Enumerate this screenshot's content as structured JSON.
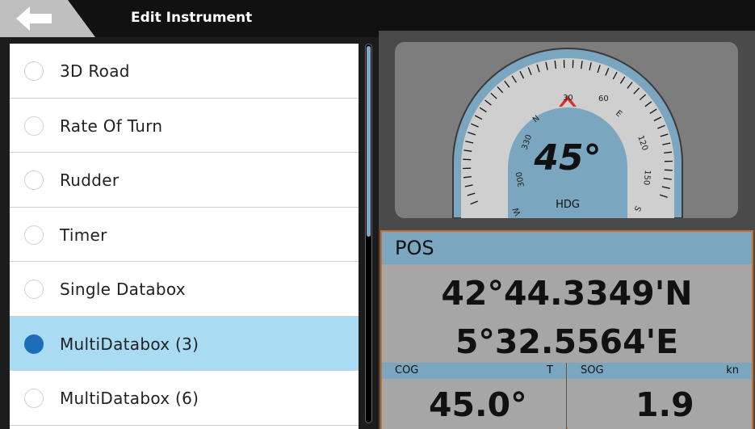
{
  "header": {
    "title": "Edit Instrument",
    "back_icon": "left-arrow-icon"
  },
  "list": {
    "items": [
      {
        "label": "3D Road",
        "selected": false
      },
      {
        "label": "Rate Of Turn",
        "selected": false
      },
      {
        "label": "Rudder",
        "selected": false
      },
      {
        "label": "Timer",
        "selected": false
      },
      {
        "label": "Single Databox",
        "selected": false
      },
      {
        "label": "MultiDatabox (3)",
        "selected": true
      },
      {
        "label": "MultiDatabox (6)",
        "selected": false
      }
    ]
  },
  "gauge": {
    "heading_value": "45°",
    "label": "HDG",
    "ticks": [
      "W",
      "300",
      "330",
      "N",
      "30",
      "60",
      "E",
      "120",
      "150",
      "S"
    ]
  },
  "position": {
    "label": "POS",
    "latitude": "42°44.3349'N",
    "longitude": "5°32.5564'E"
  },
  "cog": {
    "name": "COG",
    "unit": "T",
    "value": "45.0°"
  },
  "sog": {
    "name": "SOG",
    "unit": "kn",
    "value": "1.9"
  },
  "colors": {
    "selection": "#a9dbf3",
    "radio_selected": "#1b6eb7",
    "header_band": "#7ba6bf",
    "panel_border": "#c8702a",
    "heading_marker": "#d9302b"
  }
}
